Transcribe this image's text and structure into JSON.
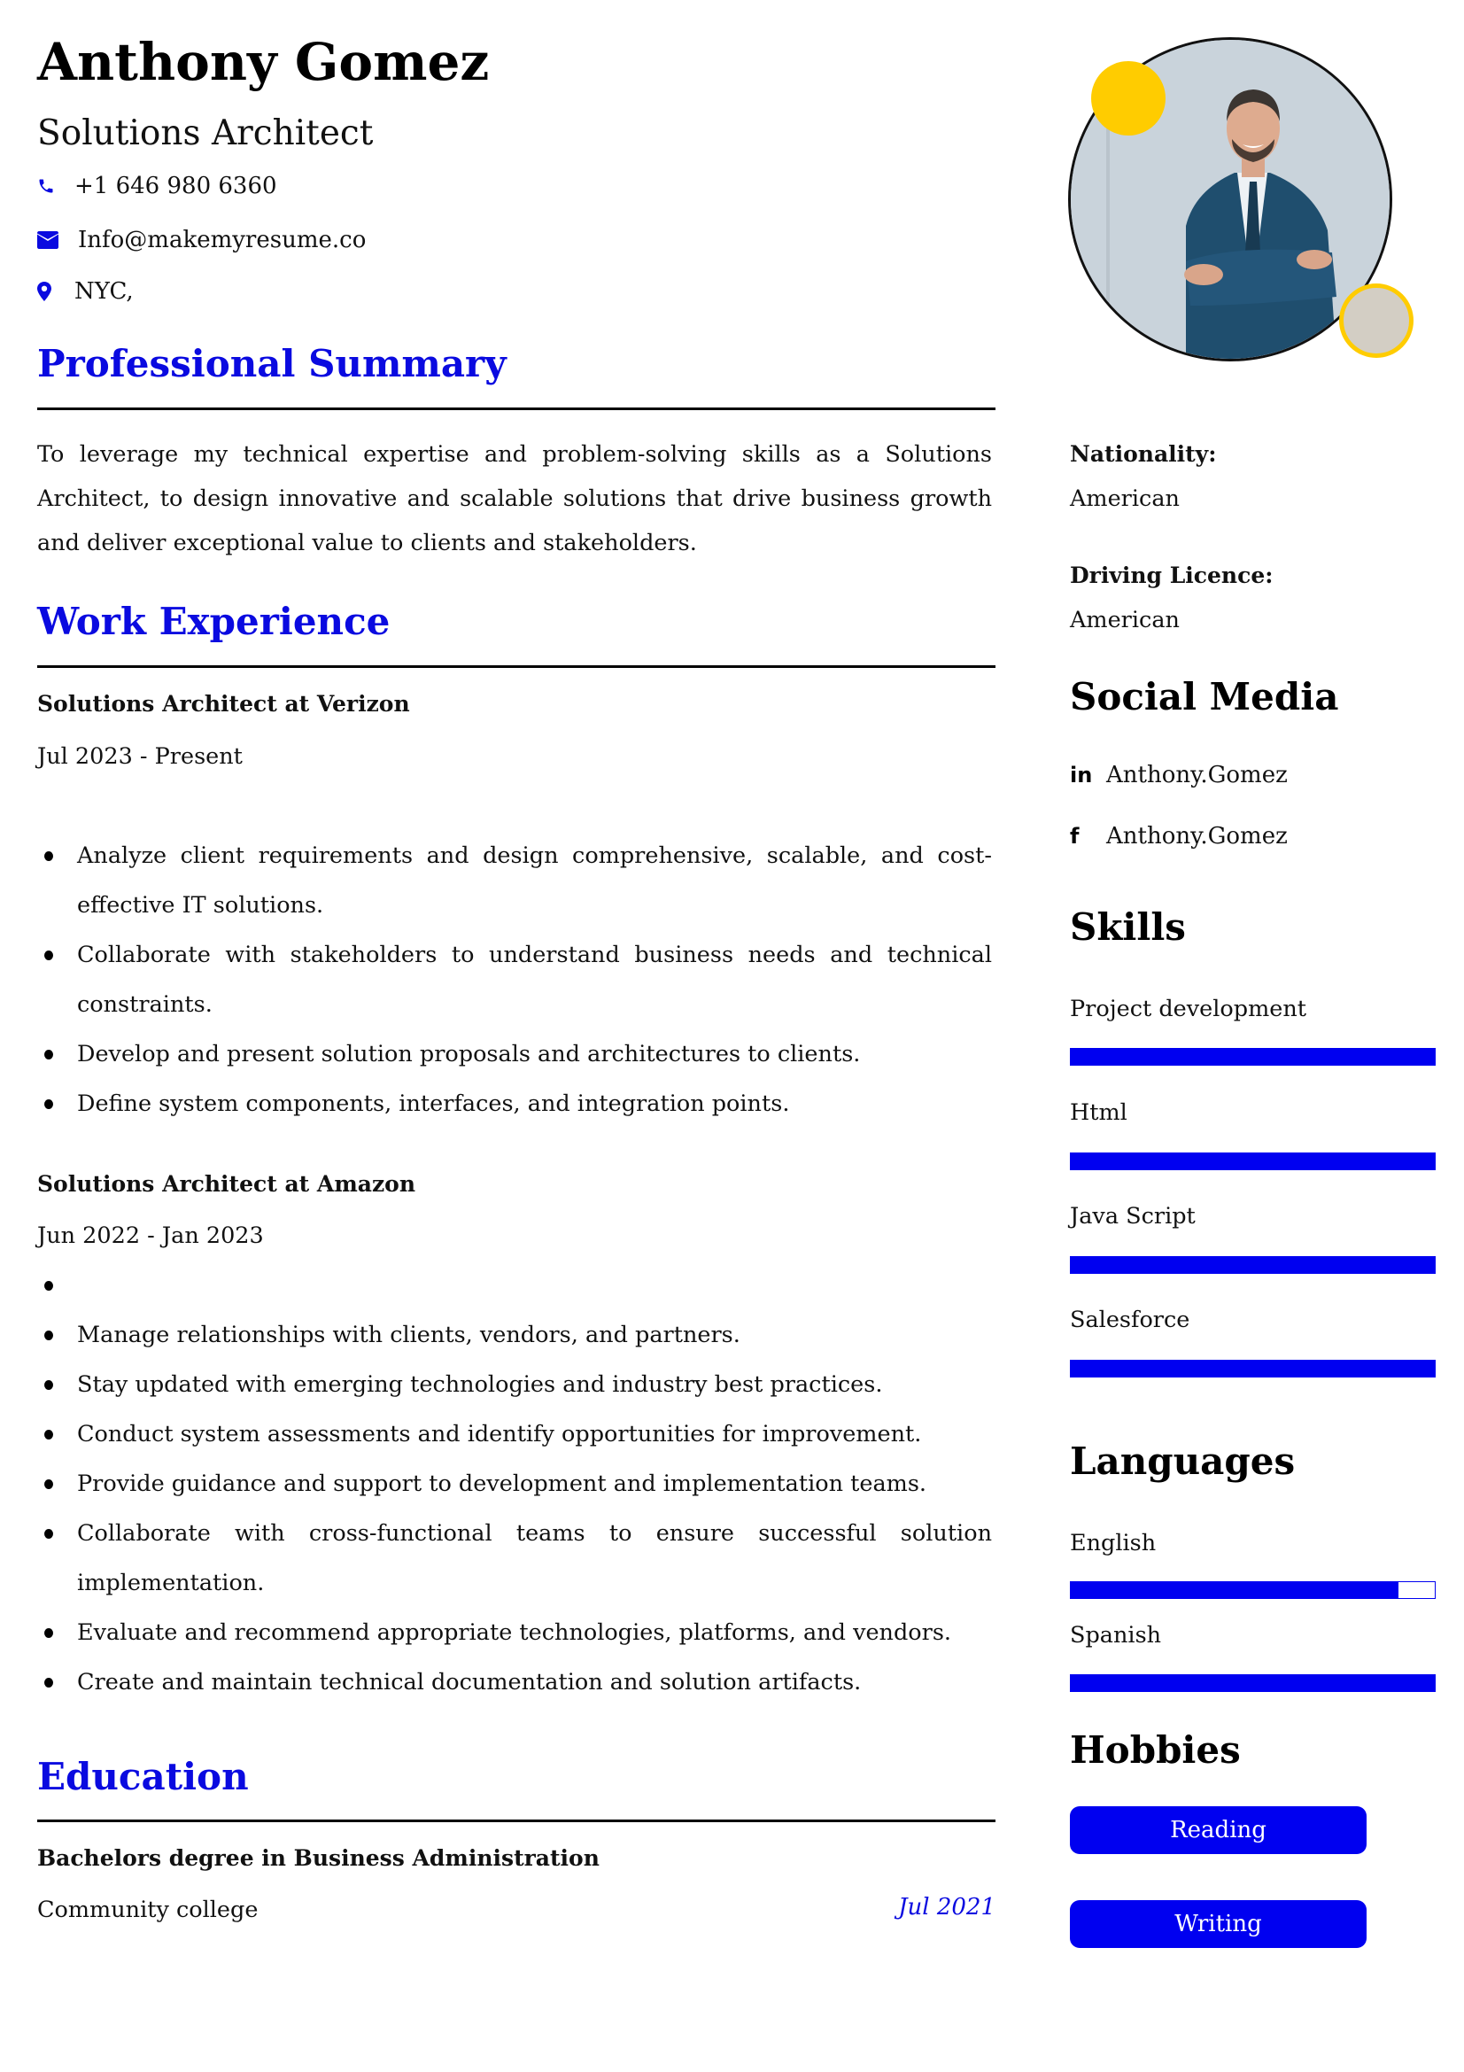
{
  "header": {
    "name": "Anthony Gomez",
    "title": "Solutions Architect",
    "contacts": [
      {
        "icon": "phone-icon",
        "text": "+1 646 980 6360"
      },
      {
        "icon": "envelope-icon",
        "text": "Info@makemyresume.co"
      },
      {
        "icon": "map-pin-icon",
        "text": "NYC,"
      }
    ]
  },
  "summary": {
    "heading": "Professional Summary",
    "text": "To leverage my technical expertise and problem-solving skills as a Solutions Architect, to design innovative and scalable solutions that drive business growth and deliver exceptional value to clients and stakeholders."
  },
  "experience": {
    "heading": "Work Experience",
    "jobs": [
      {
        "title": "Solutions Architect at Verizon",
        "dates": "Jul 2023 - Present",
        "bullets": [
          "Analyze client requirements and design comprehensive, scalable, and cost-effective IT solutions.",
          "Collaborate with stakeholders to understand business needs and technical constraints.",
          "Develop and present solution proposals and architectures to clients.",
          "Define system components, interfaces, and integration points."
        ]
      },
      {
        "title": "Solutions Architect at Amazon",
        "dates": "Jun 2022 - Jan 2023",
        "bullets": [
          "",
          "Manage relationships with clients, vendors, and partners.",
          "Stay updated with emerging technologies and industry best practices.",
          "Conduct system assessments and identify opportunities for improvement.",
          "Provide guidance and support to development and implementation teams.",
          "Collaborate with cross-functional teams to ensure successful solution implementation.",
          "Evaluate and recommend appropriate technologies, platforms, and vendors.",
          "Create and maintain technical documentation and solution artifacts."
        ]
      }
    ]
  },
  "education": {
    "heading": "Education",
    "degree": "Bachelors degree in Business Administration",
    "school": "Community college",
    "date": "Jul 2021"
  },
  "sidebar": {
    "nationality_label": "Nationality:",
    "nationality": "American",
    "licence_label": "Driving Licence:",
    "licence": "American",
    "social_heading": "Social Media",
    "social": [
      {
        "icon": "linkedin-icon",
        "glyph": "in",
        "handle": "Anthony.Gomez"
      },
      {
        "icon": "facebook-icon",
        "glyph": "f",
        "handle": "Anthony.Gomez"
      }
    ],
    "skills_heading": "Skills",
    "skills": [
      {
        "name": "Project development",
        "level": 100
      },
      {
        "name": "Html",
        "level": 100
      },
      {
        "name": "Java Script",
        "level": 100
      },
      {
        "name": "Salesforce",
        "level": 100
      }
    ],
    "languages_heading": "Languages",
    "languages": [
      {
        "name": "English",
        "level": 90
      },
      {
        "name": "Spanish",
        "level": 100
      }
    ],
    "hobbies_heading": "Hobbies",
    "hobbies": [
      "Reading",
      "Writing"
    ]
  },
  "colors": {
    "accent": "#0a0ae0",
    "bar": "#0000f0",
    "decor_yellow": "#ffcc00"
  }
}
